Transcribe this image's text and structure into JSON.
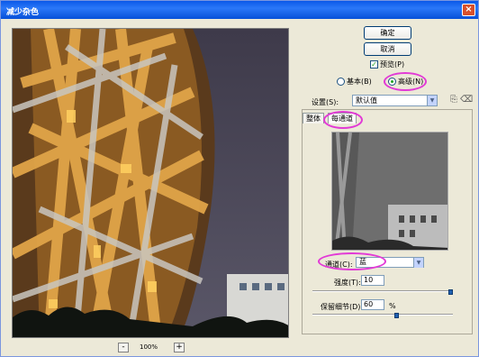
{
  "window": {
    "title": "减少杂色"
  },
  "preview": {
    "zoom": "100%",
    "zoom_out": "-",
    "zoom_in": "+"
  },
  "buttons": {
    "ok": "确定",
    "cancel": "取消"
  },
  "preview_check": {
    "label": "预览(P)",
    "checked": true
  },
  "mode": {
    "basic": "基本(B)",
    "advanced": "高级(N)",
    "selected": "advanced"
  },
  "settings": {
    "label": "设置(S):",
    "value": "默认值"
  },
  "tabs": [
    {
      "label": "整体"
    },
    {
      "label": "每通道"
    }
  ],
  "channel": {
    "label": "通道(C):",
    "value": "蓝"
  },
  "strength": {
    "label": "强度(T):",
    "value": "10",
    "level": 1.0
  },
  "preserve": {
    "label": "保留细节(D):",
    "value": "60",
    "unit": "%",
    "level": 0.6
  },
  "colors": {
    "highlight": "#e23ad6",
    "titlebar": "#0a58e8"
  }
}
